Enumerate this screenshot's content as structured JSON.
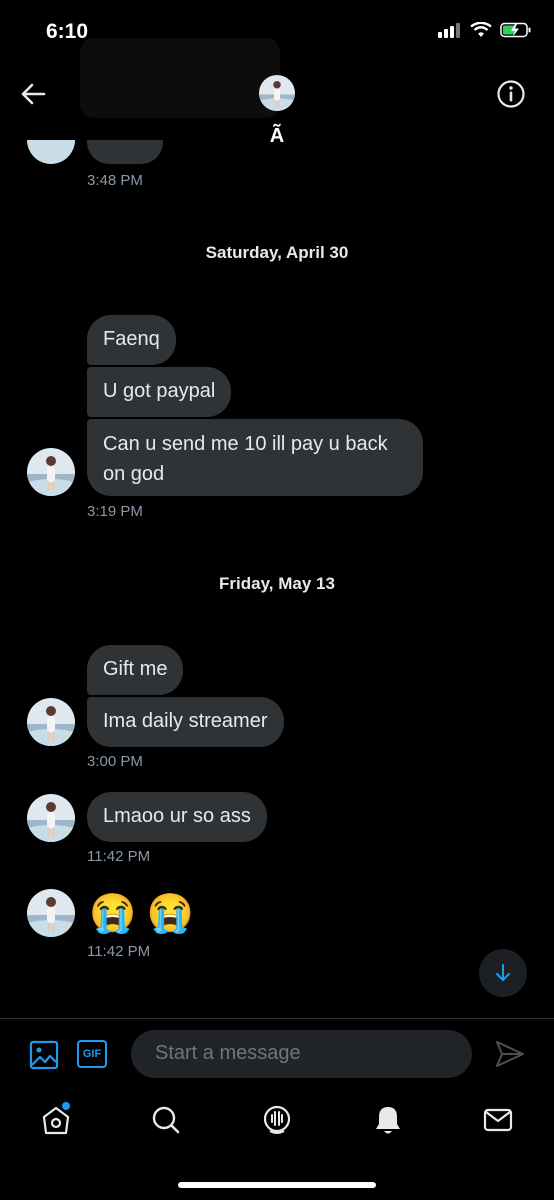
{
  "status_bar": {
    "time": "6:10"
  },
  "header": {
    "title": "Ã"
  },
  "conversation": {
    "top_time": "3:48 PM",
    "groups": [
      {
        "date": "Saturday, April 30",
        "messages": [
          "Faenq",
          "U got paypal",
          "Can u send me 10 ill pay u back on god"
        ],
        "time": "3:19 PM"
      },
      {
        "date": "Friday, May 13",
        "messages": [
          "Gift me",
          "Ima daily streamer"
        ],
        "time": "3:00 PM"
      },
      {
        "messages": [
          "Lmaoo ur so ass"
        ],
        "time": "11:42 PM"
      },
      {
        "messages": [
          "😭 😭"
        ],
        "time": "11:42 PM"
      }
    ]
  },
  "composer": {
    "placeholder": "Start a message",
    "gif_label": "GIF"
  },
  "icons": {
    "back": "back-arrow-icon",
    "info": "info-icon",
    "media": "image-icon",
    "gif": "gif-icon",
    "send": "send-icon",
    "scroll_down": "arrow-down-icon",
    "nav": [
      "home-icon",
      "search-icon",
      "spaces-icon",
      "notifications-icon",
      "messages-icon"
    ]
  },
  "colors": {
    "accent": "#1d9bf0",
    "bubble": "#2f3336",
    "background": "#000000",
    "muted": "#8b98a5"
  }
}
